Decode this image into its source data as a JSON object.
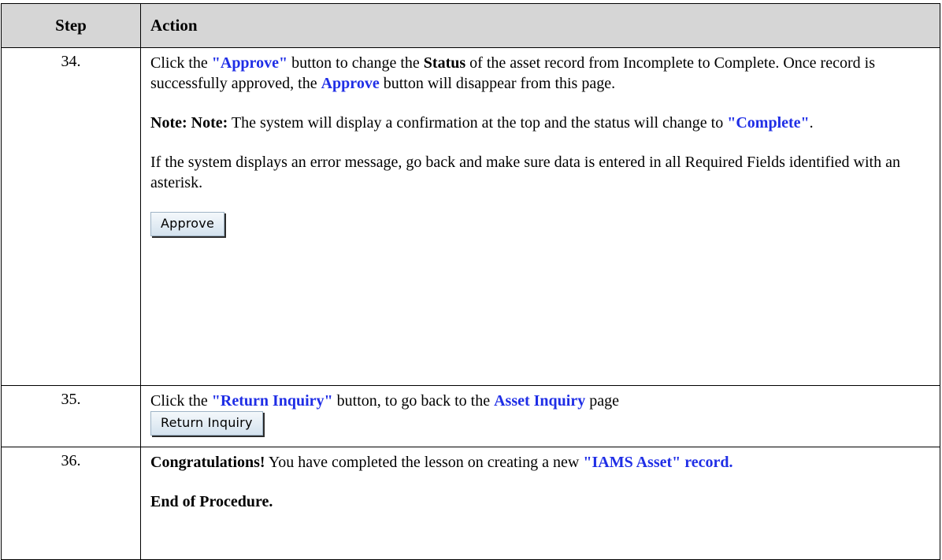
{
  "header": {
    "step": "Step",
    "action": "Action"
  },
  "rows": [
    {
      "step": "34.",
      "para1": {
        "t1": "Click the ",
        "b1": "\"Approve\"",
        "t2": " button to change the ",
        "b2": "Status",
        "t3": " of the asset record from Incomplete to Complete. Once record is successfully approved, the ",
        "b3": "Approve",
        "t4": " button will disappear from this page."
      },
      "para2": {
        "b1": "Note: Note:",
        "t1": " The system will display a confirmation at the top and the status will change to ",
        "b2": "\"Complete\"",
        "t2": "."
      },
      "para3": "If the system displays an error message, go back and make sure data is entered in all Required Fields identified with an asterisk.",
      "button": "Approve"
    },
    {
      "step": "35.",
      "para1": {
        "t1": "Click the ",
        "b1": "\"Return Inquiry\"",
        "t2": " button, to go back to the ",
        "b2": "Asset Inquiry",
        "t3": " page"
      },
      "button": "Return Inquiry"
    },
    {
      "step": "36.",
      "para1": {
        "b1": "Congratulations!",
        "t1": " You have completed the lesson on creating a new ",
        "b2": "\"IAMS Asset\" record."
      },
      "para2": "End of Procedure."
    }
  ]
}
